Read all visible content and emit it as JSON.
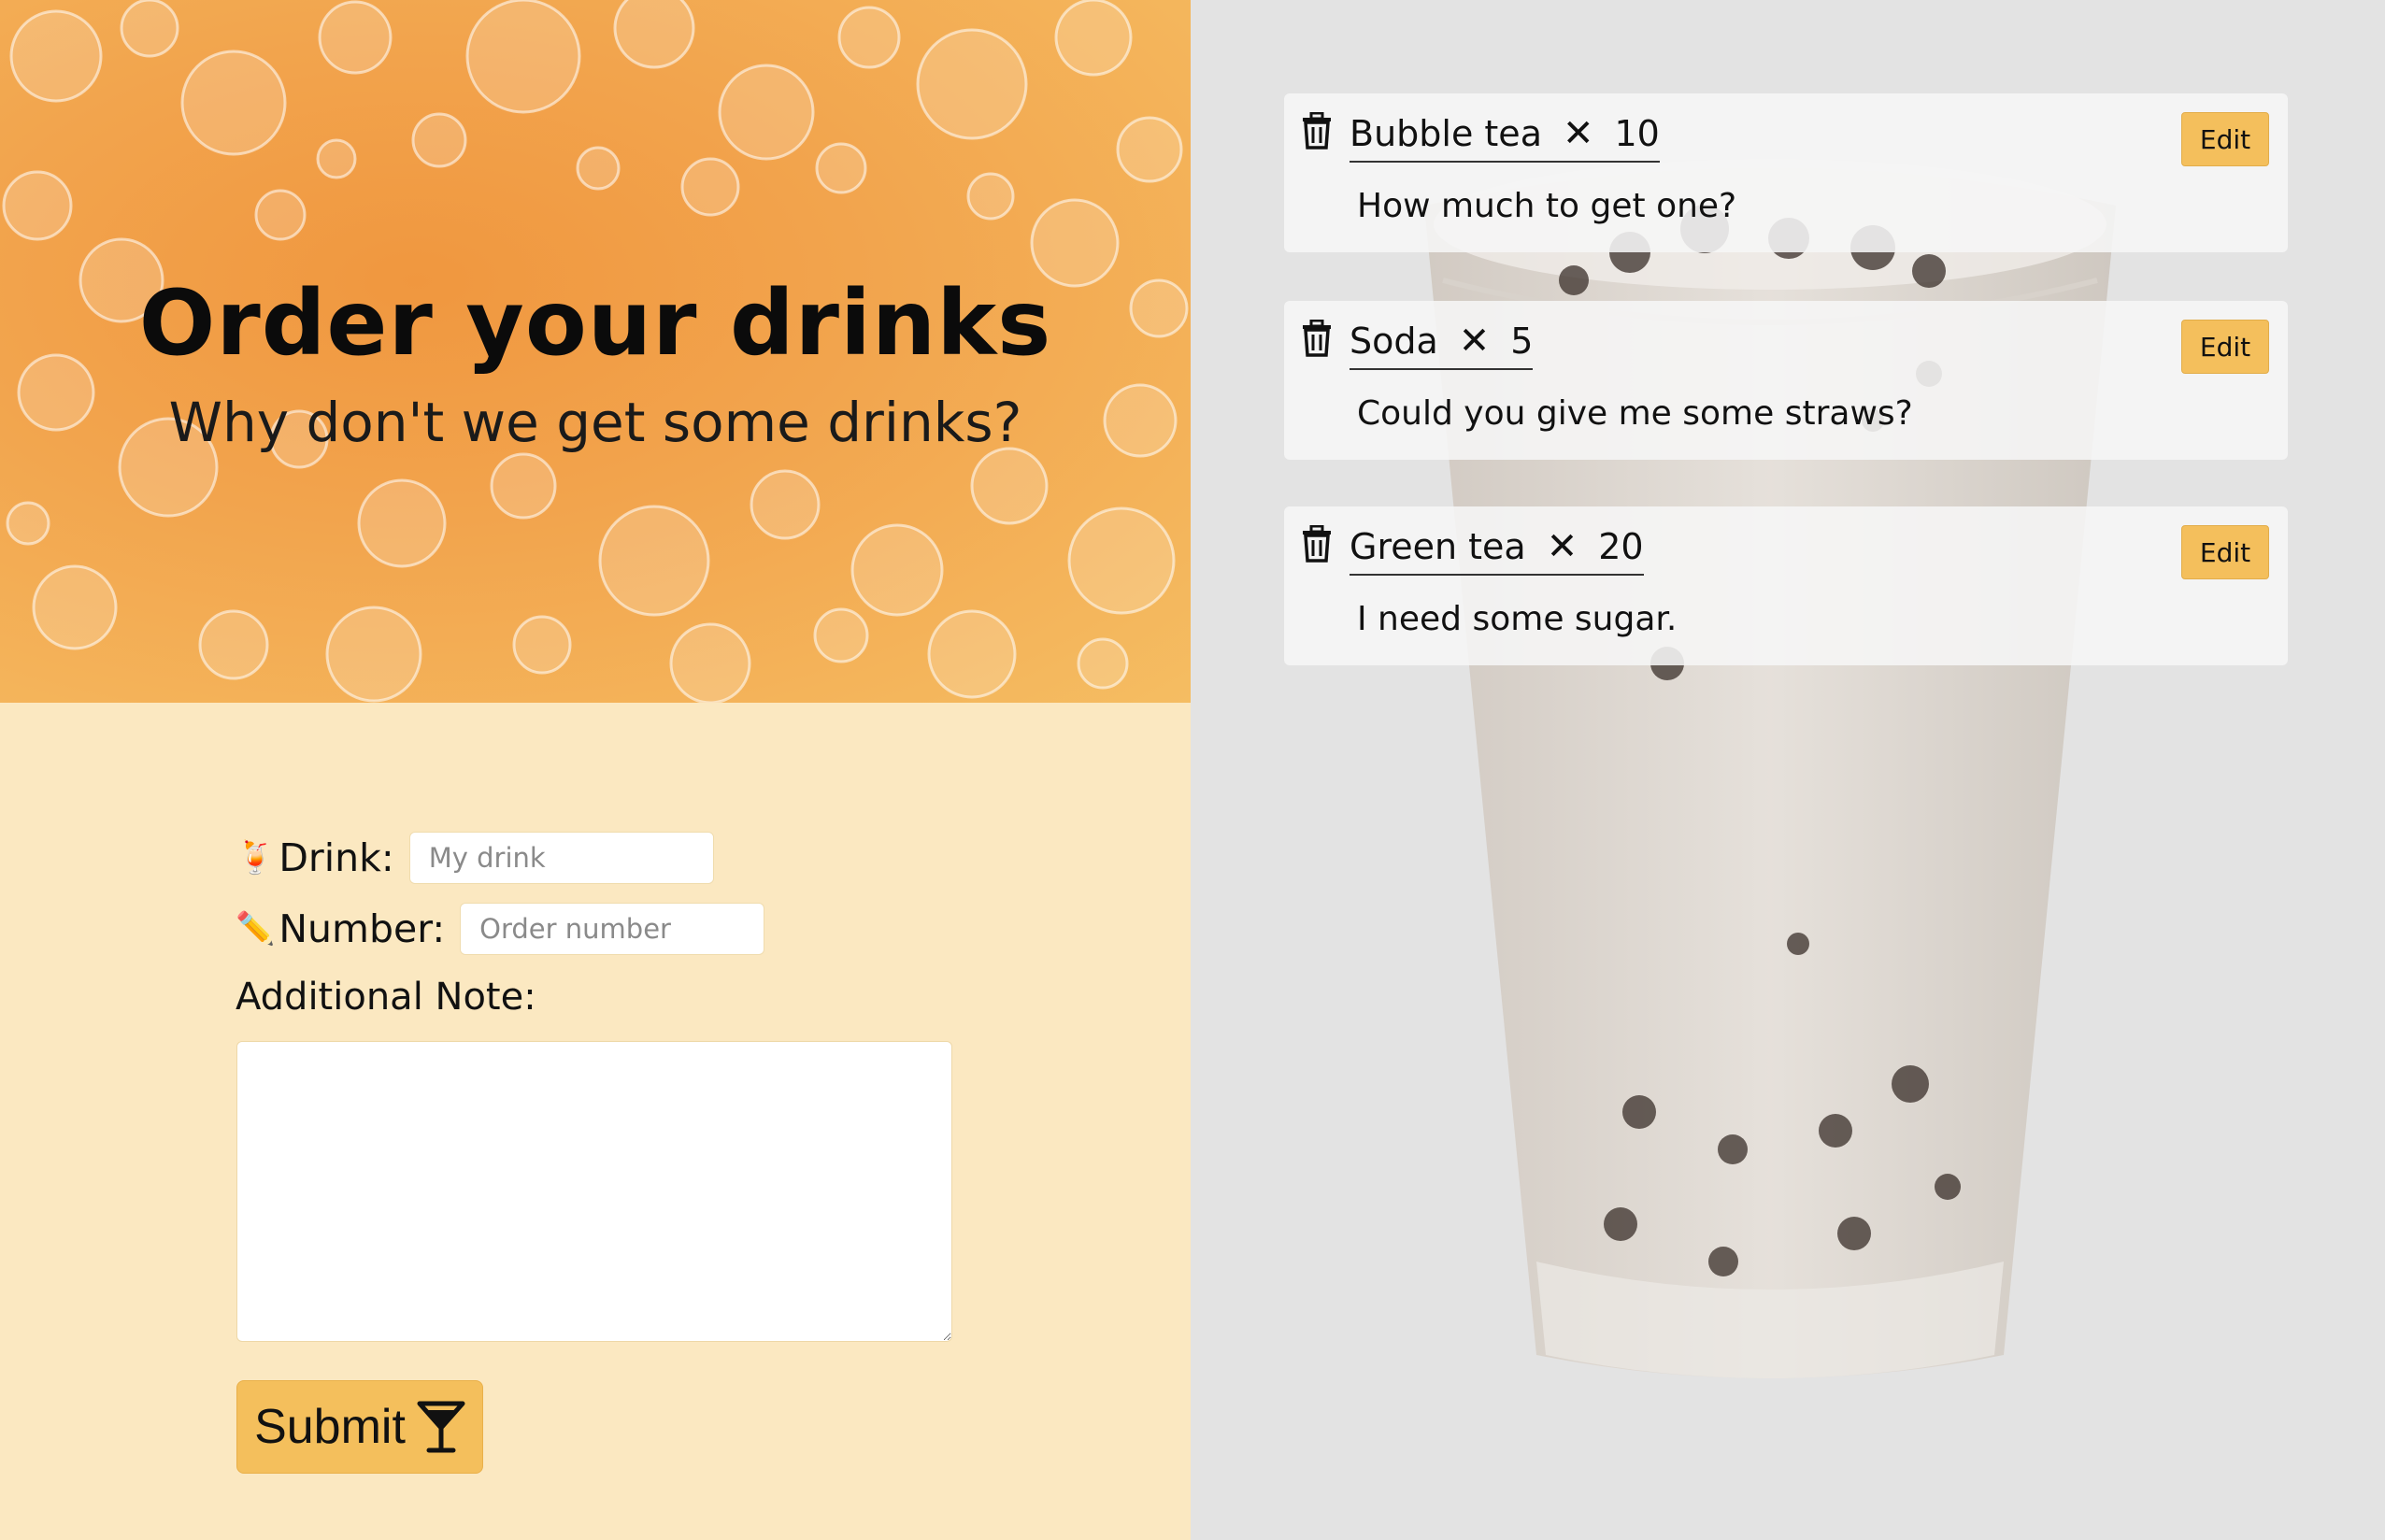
{
  "hero": {
    "title": "Order your drinks",
    "subtitle": "Why don't we get some drinks?"
  },
  "form": {
    "drink": {
      "icon": "tropical-drink-emoji",
      "emoji": "🍹",
      "label": "Drink:",
      "placeholder": "My drink"
    },
    "number": {
      "icon": "pencil-emoji",
      "emoji": "✏️",
      "label": "Number:",
      "placeholder": "Order number"
    },
    "note": {
      "label": "Additional Note:"
    },
    "submit": {
      "label": "Submit",
      "icon": "cocktail-glass-icon"
    }
  },
  "orders": [
    {
      "drink": "Bubble tea",
      "times": "✕",
      "count": "10",
      "note": "How much to get one?",
      "edit_label": "Edit"
    },
    {
      "drink": "Soda",
      "times": "✕",
      "count": "5",
      "note": "Could you give me some straws?",
      "edit_label": "Edit"
    },
    {
      "drink": "Green tea",
      "times": "✕",
      "count": "20",
      "note": "I need some sugar.",
      "edit_label": "Edit"
    }
  ],
  "colors": {
    "accent": "#f4bf5c",
    "hero_orange": "#f2a44d",
    "form_background": "#fbe8c1",
    "right_background": "#e3e3e3"
  }
}
